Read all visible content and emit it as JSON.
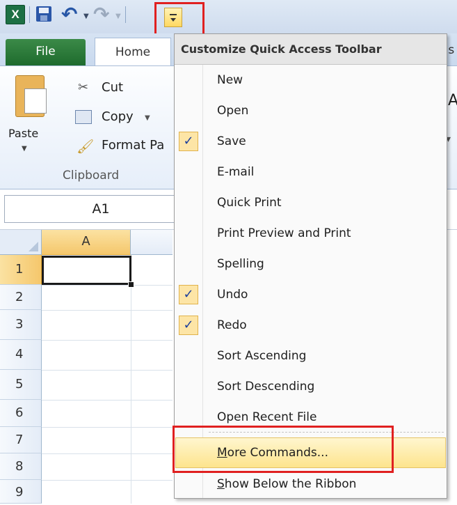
{
  "app": {
    "logo_letter": "X",
    "undo_icon": "undo-icon",
    "redo_icon": "redo-icon",
    "save_icon": "save-icon",
    "qat_customize_icon": "customize-qat-icon"
  },
  "ribbon": {
    "tabs": {
      "file": "File",
      "home": "Home",
      "partial_next": "as"
    },
    "clipboard": {
      "paste": "Paste",
      "cut": "Cut",
      "copy": "Copy",
      "format_painter": "Format Pa",
      "group_label": "Clipboard"
    },
    "partial_font_letter": "A"
  },
  "formula_bar": {
    "name_box": "A1"
  },
  "grid": {
    "column_headers": [
      "A"
    ],
    "row_headers": [
      "1",
      "2",
      "3",
      "4",
      "5",
      "6",
      "7",
      "8",
      "9"
    ],
    "selected_cell": "A1"
  },
  "menu": {
    "title": "Customize Quick Access Toolbar",
    "items": [
      {
        "label": "New",
        "checked": false
      },
      {
        "label": "Open",
        "checked": false
      },
      {
        "label": "Save",
        "checked": true
      },
      {
        "label": "E-mail",
        "checked": false
      },
      {
        "label": "Quick Print",
        "checked": false
      },
      {
        "label": "Print Preview and Print",
        "checked": false
      },
      {
        "label": "Spelling",
        "checked": false
      },
      {
        "label": "Undo",
        "checked": true
      },
      {
        "label": "Redo",
        "checked": true
      },
      {
        "label": "Sort Ascending",
        "checked": false
      },
      {
        "label": "Sort Descending",
        "checked": false
      },
      {
        "label": "Open Recent File",
        "checked": false
      }
    ],
    "more_commands": {
      "accel": "M",
      "rest": "ore Commands..."
    },
    "show_below": {
      "accel": "S",
      "rest": "how Below the Ribbon"
    },
    "check_glyph": "✓"
  },
  "colors": {
    "highlight_box": "#e02020",
    "hover_fill": "#fde48d",
    "file_tab": "#2a7a39"
  }
}
